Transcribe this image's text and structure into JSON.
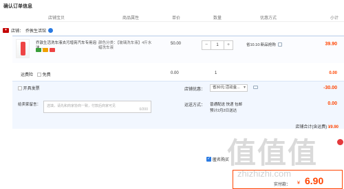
{
  "page_title": "确认订单信息",
  "columns": [
    "店铺宝贝",
    "商品属性",
    "单价",
    "数量",
    "优惠方式",
    "小计"
  ],
  "shop": {
    "label": "店铺：",
    "name": "乔敦生活馆"
  },
  "item": {
    "name": "乔敦生活洗车液去污增亮汽车专用泡沫...",
    "sku": "颜色分类：【玻璃洗车液】4斤水蜡洗车液",
    "price": "50.00",
    "quantity": "1",
    "minus": "−",
    "plus": "+",
    "promo": "省10.10:新品抢购",
    "subtotal": "39.90"
  },
  "shipping_insurance": {
    "label": "运费险",
    "option": "免费",
    "price": "0.00",
    "qty": "1",
    "subtotal": "0.00"
  },
  "invoice": {
    "label": "开具发票"
  },
  "coupon": {
    "label": "店铺优惠：",
    "selected": "省30元:活动金...",
    "amount": "-30.00"
  },
  "message": {
    "label": "给卖家留言：",
    "placeholder": "选填，请先和商家协商一致，付款后商家可见",
    "count": "0/200"
  },
  "delivery": {
    "label": "运送方式：",
    "method": "普通配送 快递 包邮",
    "eta": "预计2月2日送达",
    "price": "0.00"
  },
  "shop_total": {
    "label": "店铺合计(含运费)",
    "amount": "¥9.90"
  },
  "agreement": {
    "label": "匿名购买"
  },
  "payment": {
    "label": "实付款：",
    "currency": "¥",
    "amount": "6.90"
  },
  "watermark": {
    "brand": "值值值",
    "url": "zhizhizhi.com"
  },
  "colors": {
    "accent": "#ff4400",
    "blue": "#2a7ae2"
  }
}
